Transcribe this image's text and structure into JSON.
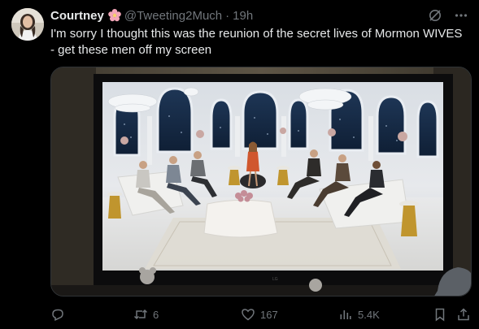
{
  "author": {
    "display_name": "Courtney",
    "handle": "@Tweeting2Much",
    "separator": "·",
    "time": "19h",
    "badge_icon": "cherry-blossom-icon"
  },
  "tweet": {
    "text": "I'm sorry I thought this was the reunion of the secret lives of Mormon WIVES - get these men off my screen"
  },
  "media": {
    "description_icon": "tv-photo"
  },
  "actions": {
    "reply_count": "",
    "retweet_count": "6",
    "like_count": "167",
    "view_count": "5.4K"
  },
  "colors": {
    "background": "#000000",
    "text_primary": "#e7e9ea",
    "text_secondary": "#71767b",
    "border": "#2f3336"
  }
}
